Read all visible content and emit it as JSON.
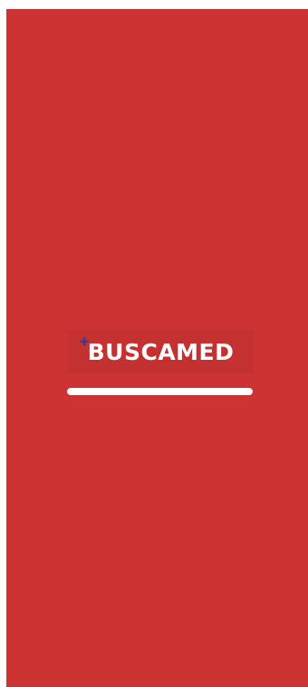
{
  "app": {
    "brand_name": "BUSCAMED"
  },
  "icons": {
    "logo_mark": "cross-icon"
  },
  "loading": {
    "progress_fraction": 1.0
  },
  "colors": {
    "background": "#cc3332",
    "logo_mark": "#2c3e8f",
    "progress_bar": "#ffffff"
  }
}
